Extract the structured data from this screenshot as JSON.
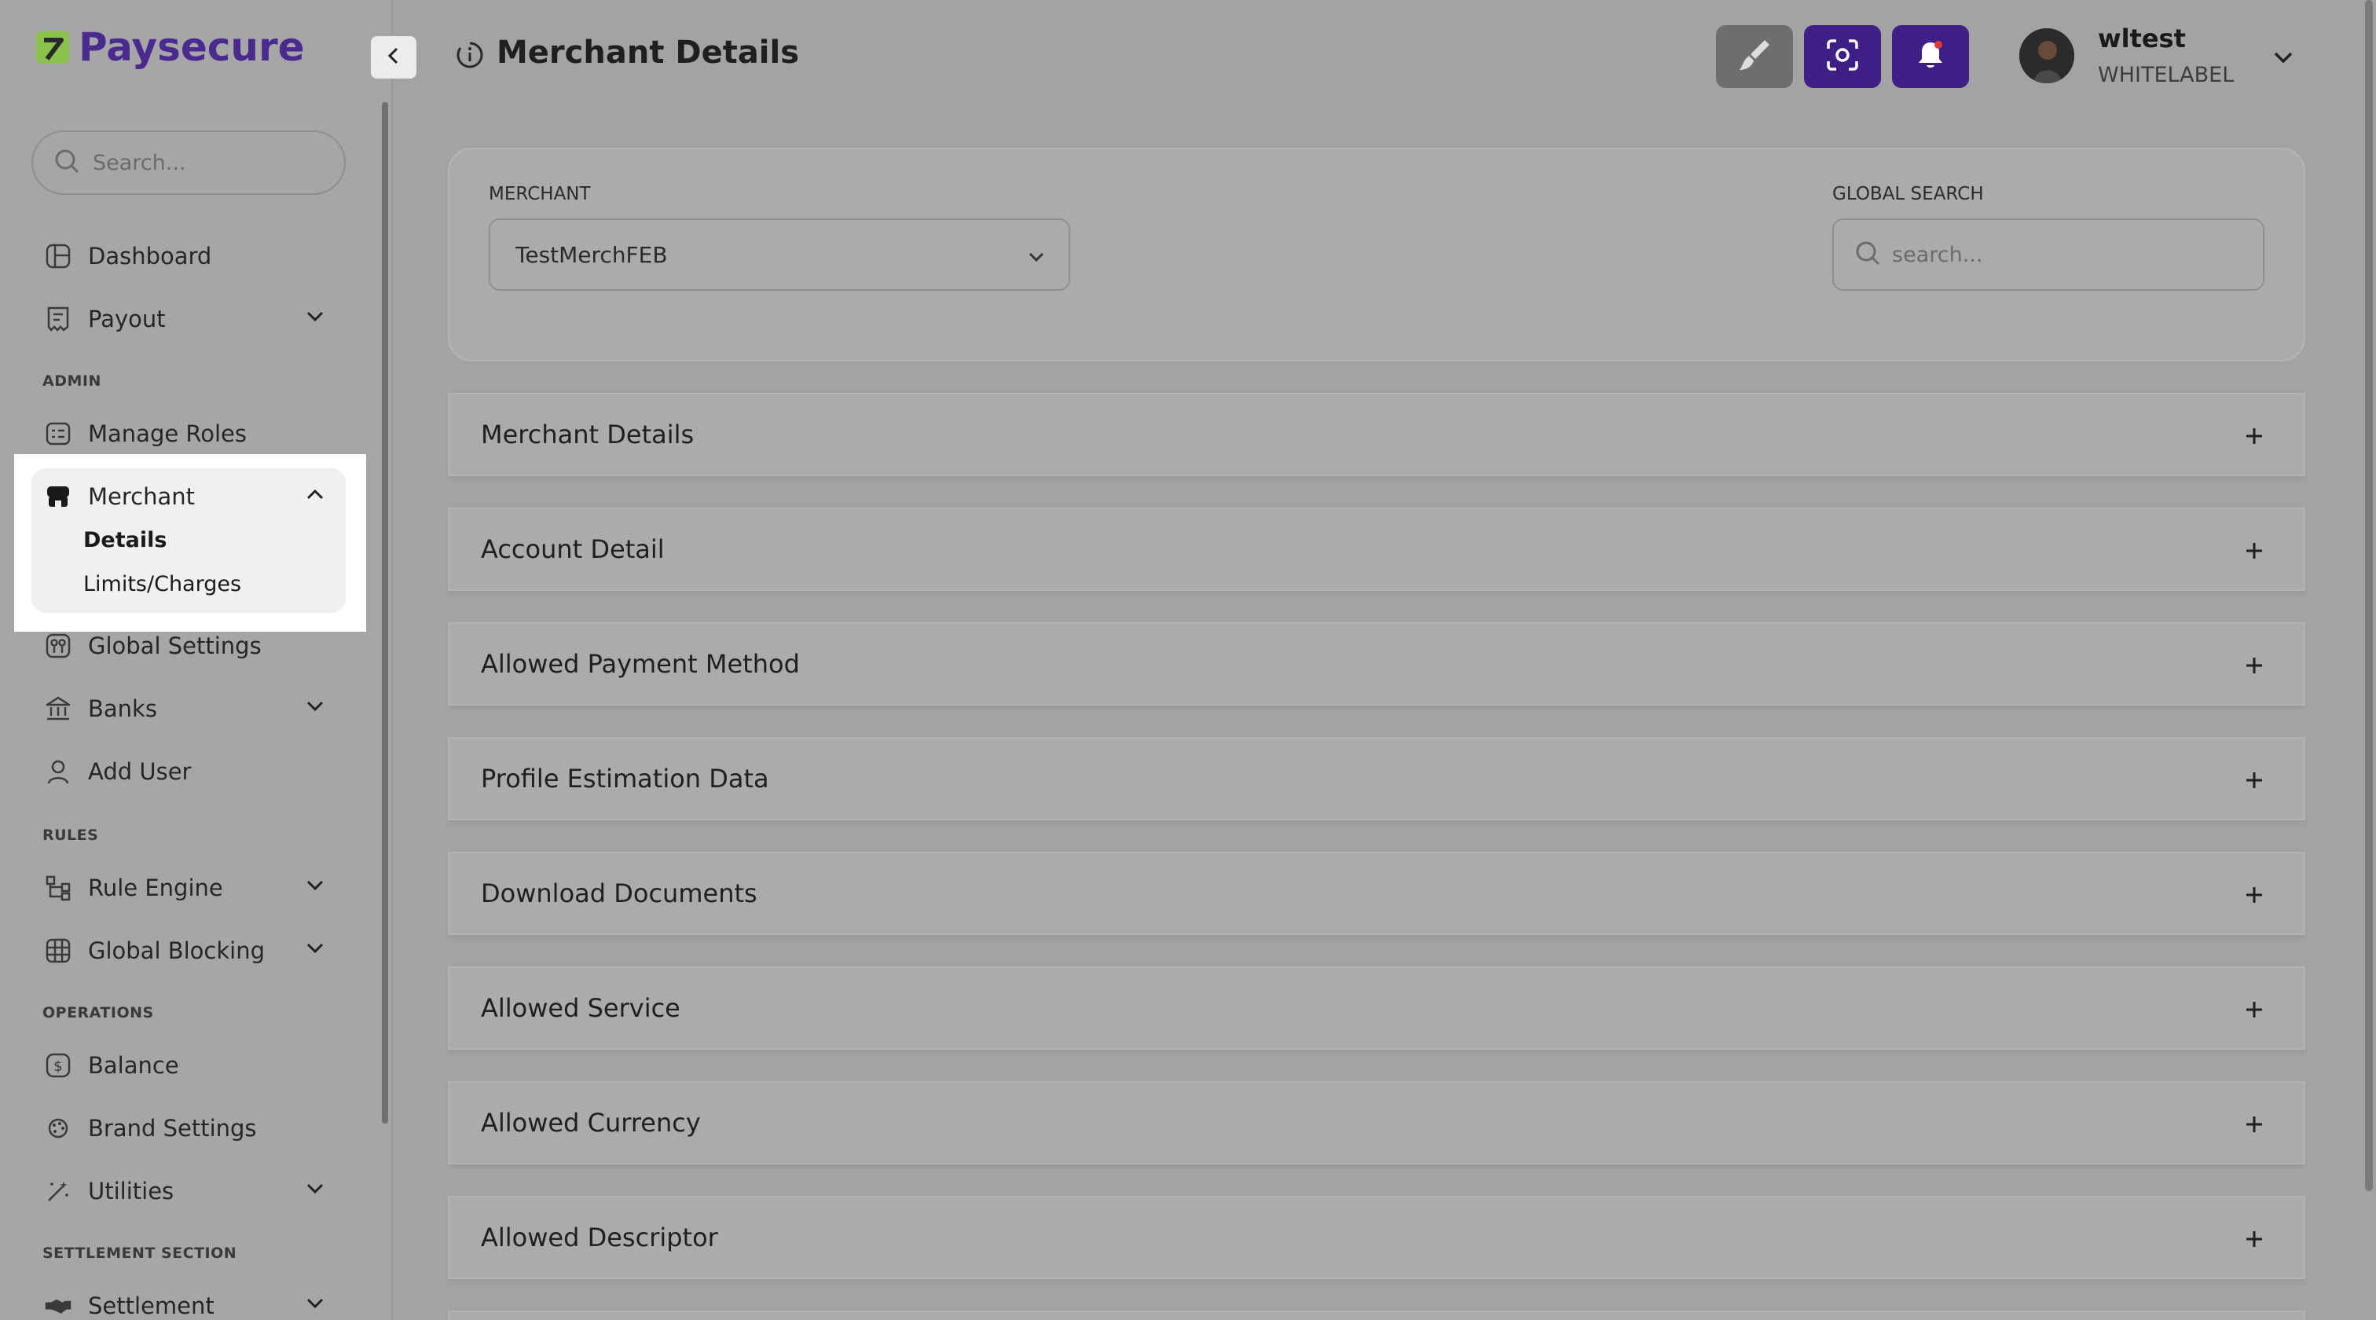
{
  "app": {
    "brand": "Paysecure",
    "page_title": "Merchant Details"
  },
  "sidebar": {
    "search_placeholder": "Search...",
    "items": [
      {
        "label": "Dashboard",
        "icon": "dashboard-icon"
      },
      {
        "label": "Payout",
        "icon": "payout-icon",
        "expandable": true
      }
    ],
    "sections": {
      "admin": "ADMIN",
      "rules": "RULES",
      "operations": "OPERATIONS",
      "settlement": "SETTLEMENT SECTION"
    },
    "admin_items": {
      "manage_roles": "Manage Roles",
      "merchant": "Merchant",
      "merchant_sub": [
        "Details",
        "Limits/Charges"
      ],
      "global_settings": "Global Settings",
      "banks": "Banks",
      "add_user": "Add User"
    },
    "rules_items": {
      "rule_engine": "Rule Engine",
      "global_blocking": "Global Blocking"
    },
    "operations_items": {
      "balance": "Balance",
      "brand_settings": "Brand Settings",
      "utilities": "Utilities"
    },
    "settlement_items": {
      "settlement": "Settlement"
    }
  },
  "header": {
    "user_name": "wltest",
    "user_role": "WHITELABEL",
    "buttons": [
      "brush-icon",
      "screenshot-icon",
      "bell-icon"
    ],
    "accent_color": "#4a2a8e",
    "bell_color": "#3e1f86"
  },
  "filters": {
    "merchant_label": "MERCHANT",
    "merchant_value": "TestMerchFEB",
    "global_search_label": "GLOBAL SEARCH",
    "global_search_placeholder": "search..."
  },
  "accordion": [
    "Merchant Details",
    "Account Detail",
    "Allowed Payment Method",
    "Profile Estimation Data",
    "Download Documents",
    "Allowed Service",
    "Allowed Currency",
    "Allowed Descriptor"
  ]
}
